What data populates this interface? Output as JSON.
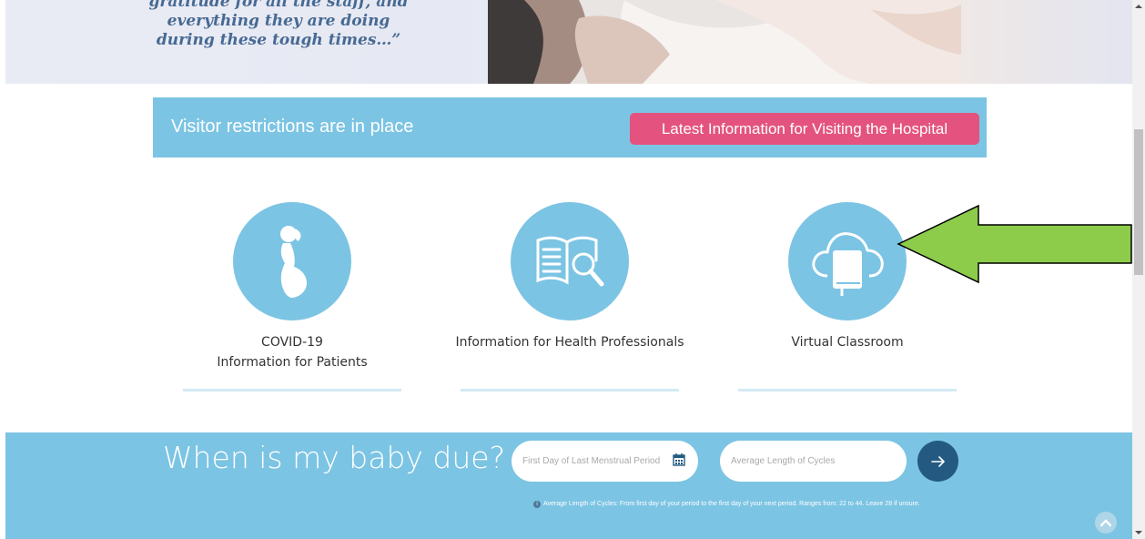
{
  "hero": {
    "quote_line1": "gratitude for all the staff, and",
    "quote_line2": "everything they are doing",
    "quote_line3": "during these tough times…”"
  },
  "visitor": {
    "text": "Visitor restrictions are in place",
    "button": "Latest Information for Visiting the Hospital"
  },
  "cards": [
    {
      "line1": "COVID-19",
      "line2": "Information for Patients",
      "icon": "pregnant-woman-icon"
    },
    {
      "line1": "Information for Health Professionals",
      "icon": "book-search-icon"
    },
    {
      "line1": "Virtual Classroom",
      "icon": "cloud-book-icon"
    }
  ],
  "due": {
    "title": "When is my baby due?",
    "date_placeholder": "First Day of Last Menstrual Period",
    "length_placeholder": "Average Length of Cycles",
    "note": "Average Length of Cycles: From first day of your period to the first day of your next period. Ranges from: 22 to 44. Leave 28 if unsure."
  },
  "colors": {
    "accent_blue": "#7cc4e3",
    "pink": "#e4537f",
    "navy": "#245a82",
    "annotation_green": "#8dcc4b"
  }
}
